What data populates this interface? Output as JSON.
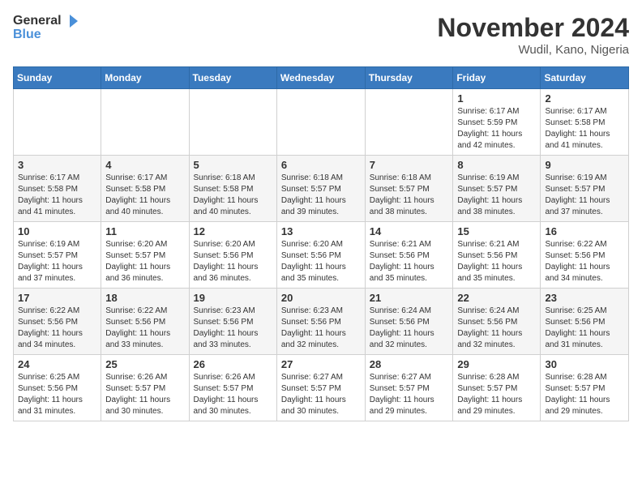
{
  "logo": {
    "text_general": "General",
    "text_blue": "Blue"
  },
  "title": "November 2024",
  "location": "Wudil, Kano, Nigeria",
  "weekdays": [
    "Sunday",
    "Monday",
    "Tuesday",
    "Wednesday",
    "Thursday",
    "Friday",
    "Saturday"
  ],
  "weeks": [
    [
      {
        "day": "",
        "sunrise": "",
        "sunset": "",
        "daylight": ""
      },
      {
        "day": "",
        "sunrise": "",
        "sunset": "",
        "daylight": ""
      },
      {
        "day": "",
        "sunrise": "",
        "sunset": "",
        "daylight": ""
      },
      {
        "day": "",
        "sunrise": "",
        "sunset": "",
        "daylight": ""
      },
      {
        "day": "",
        "sunrise": "",
        "sunset": "",
        "daylight": ""
      },
      {
        "day": "1",
        "sunrise": "Sunrise: 6:17 AM",
        "sunset": "Sunset: 5:59 PM",
        "daylight": "Daylight: 11 hours and 42 minutes."
      },
      {
        "day": "2",
        "sunrise": "Sunrise: 6:17 AM",
        "sunset": "Sunset: 5:58 PM",
        "daylight": "Daylight: 11 hours and 41 minutes."
      }
    ],
    [
      {
        "day": "3",
        "sunrise": "Sunrise: 6:17 AM",
        "sunset": "Sunset: 5:58 PM",
        "daylight": "Daylight: 11 hours and 41 minutes."
      },
      {
        "day": "4",
        "sunrise": "Sunrise: 6:17 AM",
        "sunset": "Sunset: 5:58 PM",
        "daylight": "Daylight: 11 hours and 40 minutes."
      },
      {
        "day": "5",
        "sunrise": "Sunrise: 6:18 AM",
        "sunset": "Sunset: 5:58 PM",
        "daylight": "Daylight: 11 hours and 40 minutes."
      },
      {
        "day": "6",
        "sunrise": "Sunrise: 6:18 AM",
        "sunset": "Sunset: 5:57 PM",
        "daylight": "Daylight: 11 hours and 39 minutes."
      },
      {
        "day": "7",
        "sunrise": "Sunrise: 6:18 AM",
        "sunset": "Sunset: 5:57 PM",
        "daylight": "Daylight: 11 hours and 38 minutes."
      },
      {
        "day": "8",
        "sunrise": "Sunrise: 6:19 AM",
        "sunset": "Sunset: 5:57 PM",
        "daylight": "Daylight: 11 hours and 38 minutes."
      },
      {
        "day": "9",
        "sunrise": "Sunrise: 6:19 AM",
        "sunset": "Sunset: 5:57 PM",
        "daylight": "Daylight: 11 hours and 37 minutes."
      }
    ],
    [
      {
        "day": "10",
        "sunrise": "Sunrise: 6:19 AM",
        "sunset": "Sunset: 5:57 PM",
        "daylight": "Daylight: 11 hours and 37 minutes."
      },
      {
        "day": "11",
        "sunrise": "Sunrise: 6:20 AM",
        "sunset": "Sunset: 5:57 PM",
        "daylight": "Daylight: 11 hours and 36 minutes."
      },
      {
        "day": "12",
        "sunrise": "Sunrise: 6:20 AM",
        "sunset": "Sunset: 5:56 PM",
        "daylight": "Daylight: 11 hours and 36 minutes."
      },
      {
        "day": "13",
        "sunrise": "Sunrise: 6:20 AM",
        "sunset": "Sunset: 5:56 PM",
        "daylight": "Daylight: 11 hours and 35 minutes."
      },
      {
        "day": "14",
        "sunrise": "Sunrise: 6:21 AM",
        "sunset": "Sunset: 5:56 PM",
        "daylight": "Daylight: 11 hours and 35 minutes."
      },
      {
        "day": "15",
        "sunrise": "Sunrise: 6:21 AM",
        "sunset": "Sunset: 5:56 PM",
        "daylight": "Daylight: 11 hours and 35 minutes."
      },
      {
        "day": "16",
        "sunrise": "Sunrise: 6:22 AM",
        "sunset": "Sunset: 5:56 PM",
        "daylight": "Daylight: 11 hours and 34 minutes."
      }
    ],
    [
      {
        "day": "17",
        "sunrise": "Sunrise: 6:22 AM",
        "sunset": "Sunset: 5:56 PM",
        "daylight": "Daylight: 11 hours and 34 minutes."
      },
      {
        "day": "18",
        "sunrise": "Sunrise: 6:22 AM",
        "sunset": "Sunset: 5:56 PM",
        "daylight": "Daylight: 11 hours and 33 minutes."
      },
      {
        "day": "19",
        "sunrise": "Sunrise: 6:23 AM",
        "sunset": "Sunset: 5:56 PM",
        "daylight": "Daylight: 11 hours and 33 minutes."
      },
      {
        "day": "20",
        "sunrise": "Sunrise: 6:23 AM",
        "sunset": "Sunset: 5:56 PM",
        "daylight": "Daylight: 11 hours and 32 minutes."
      },
      {
        "day": "21",
        "sunrise": "Sunrise: 6:24 AM",
        "sunset": "Sunset: 5:56 PM",
        "daylight": "Daylight: 11 hours and 32 minutes."
      },
      {
        "day": "22",
        "sunrise": "Sunrise: 6:24 AM",
        "sunset": "Sunset: 5:56 PM",
        "daylight": "Daylight: 11 hours and 32 minutes."
      },
      {
        "day": "23",
        "sunrise": "Sunrise: 6:25 AM",
        "sunset": "Sunset: 5:56 PM",
        "daylight": "Daylight: 11 hours and 31 minutes."
      }
    ],
    [
      {
        "day": "24",
        "sunrise": "Sunrise: 6:25 AM",
        "sunset": "Sunset: 5:56 PM",
        "daylight": "Daylight: 11 hours and 31 minutes."
      },
      {
        "day": "25",
        "sunrise": "Sunrise: 6:26 AM",
        "sunset": "Sunset: 5:57 PM",
        "daylight": "Daylight: 11 hours and 30 minutes."
      },
      {
        "day": "26",
        "sunrise": "Sunrise: 6:26 AM",
        "sunset": "Sunset: 5:57 PM",
        "daylight": "Daylight: 11 hours and 30 minutes."
      },
      {
        "day": "27",
        "sunrise": "Sunrise: 6:27 AM",
        "sunset": "Sunset: 5:57 PM",
        "daylight": "Daylight: 11 hours and 30 minutes."
      },
      {
        "day": "28",
        "sunrise": "Sunrise: 6:27 AM",
        "sunset": "Sunset: 5:57 PM",
        "daylight": "Daylight: 11 hours and 29 minutes."
      },
      {
        "day": "29",
        "sunrise": "Sunrise: 6:28 AM",
        "sunset": "Sunset: 5:57 PM",
        "daylight": "Daylight: 11 hours and 29 minutes."
      },
      {
        "day": "30",
        "sunrise": "Sunrise: 6:28 AM",
        "sunset": "Sunset: 5:57 PM",
        "daylight": "Daylight: 11 hours and 29 minutes."
      }
    ]
  ]
}
